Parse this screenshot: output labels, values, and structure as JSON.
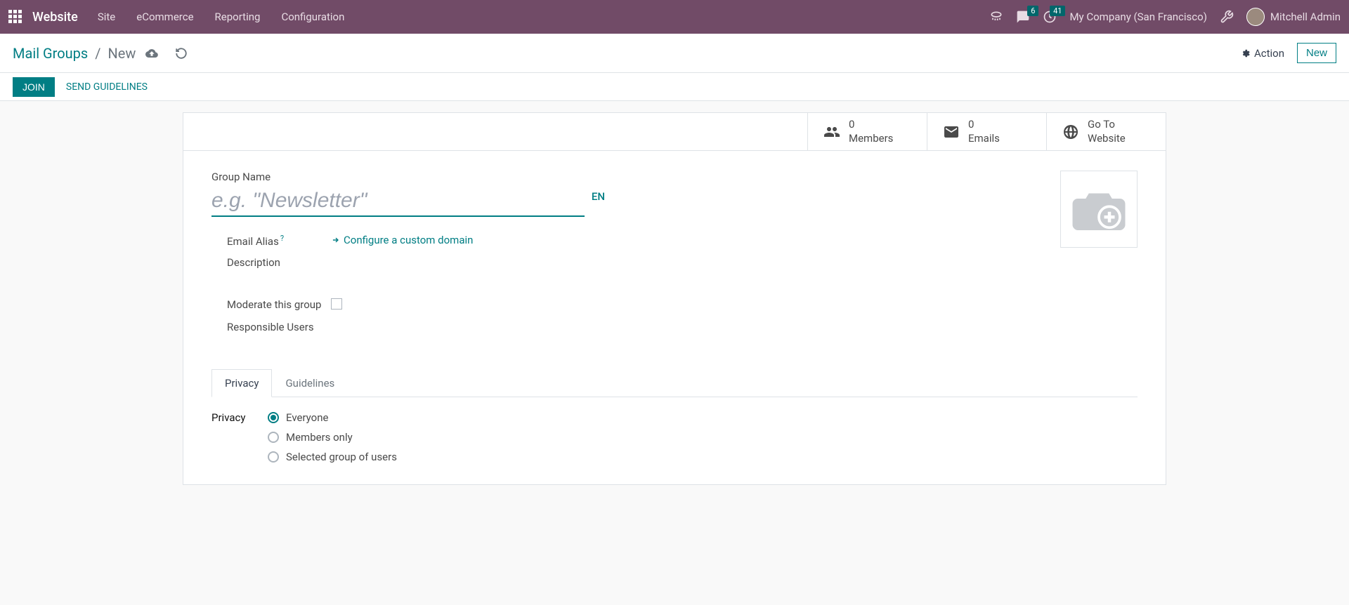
{
  "topbar": {
    "brand": "Website",
    "menu": [
      "Site",
      "eCommerce",
      "Reporting",
      "Configuration"
    ],
    "messages_badge": "6",
    "activities_badge": "41",
    "company": "My Company (San Francisco)",
    "user_name": "Mitchell Admin"
  },
  "breadcrumb": {
    "root": "Mail Groups",
    "current": "New",
    "action_label": "Action",
    "new_label": "New"
  },
  "toolbar": {
    "join": "JOIN",
    "send_guidelines": "SEND GUIDELINES"
  },
  "stats": {
    "members_count": "0",
    "members_label": "Members",
    "emails_count": "0",
    "emails_label": "Emails",
    "goto_line1": "Go To",
    "goto_line2": "Website"
  },
  "form": {
    "group_name_label": "Group Name",
    "group_name_placeholder": "e.g. \"Newsletter\"",
    "lang": "EN",
    "email_alias_label": "Email Alias",
    "configure_domain": "Configure a custom domain",
    "description_label": "Description",
    "moderate_label": "Moderate this group",
    "responsible_label": "Responsible Users"
  },
  "tabs": {
    "privacy": "Privacy",
    "guidelines": "Guidelines"
  },
  "privacy": {
    "label": "Privacy",
    "opt_everyone": "Everyone",
    "opt_members": "Members only",
    "opt_selected": "Selected group of users"
  }
}
